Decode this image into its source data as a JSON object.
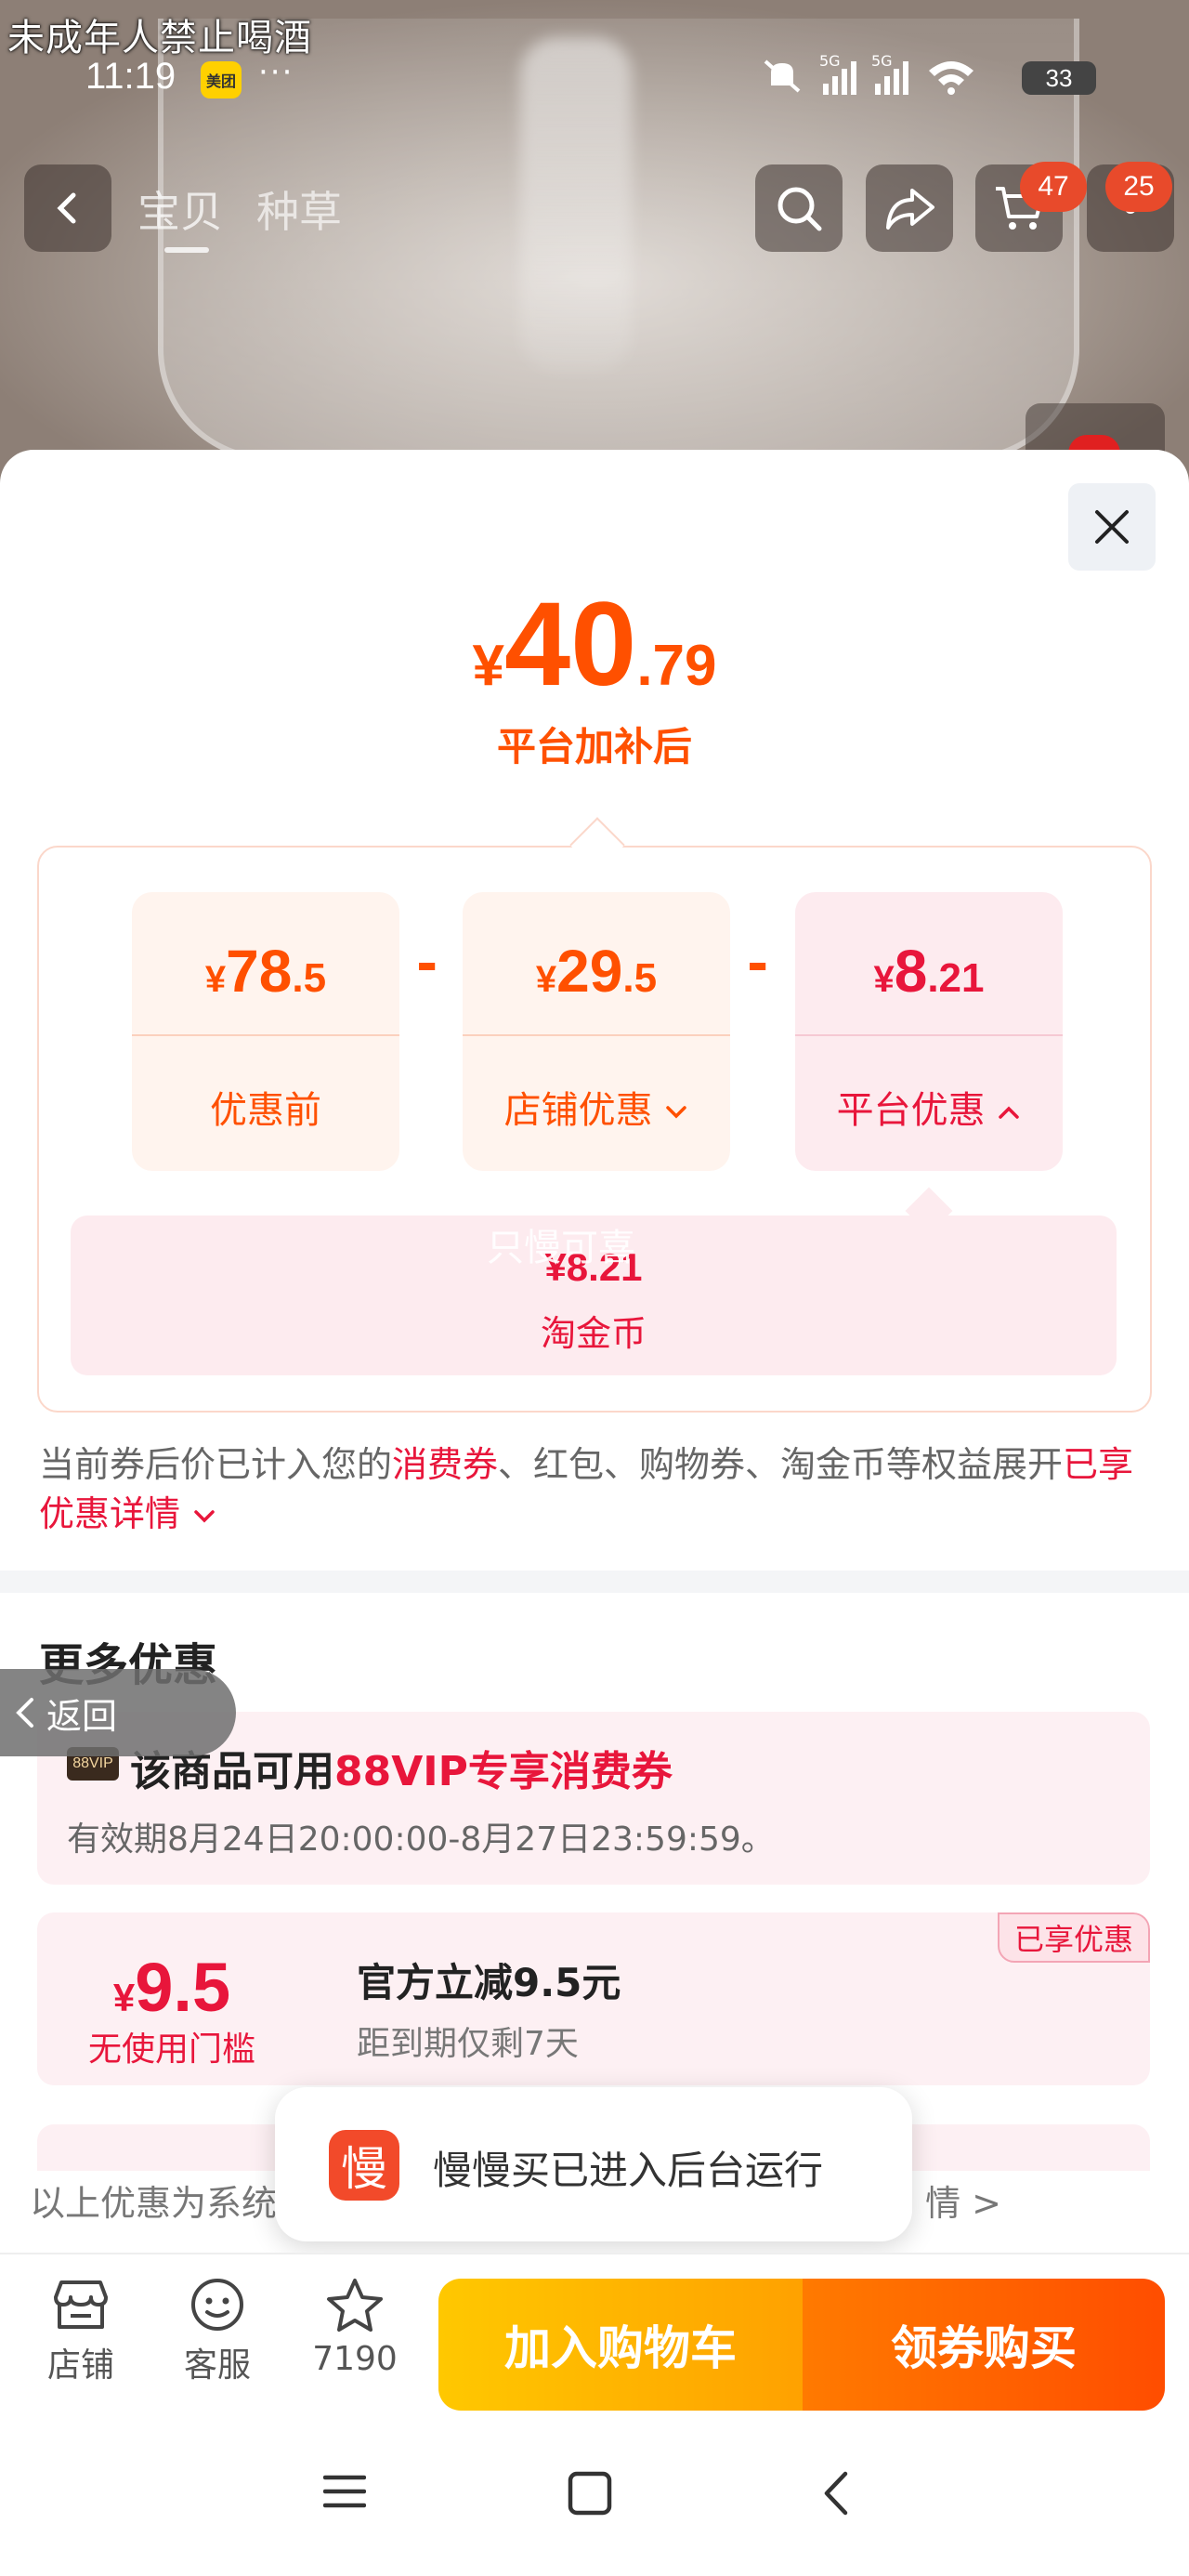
{
  "status_bar": {
    "age_warning": "未成年人禁止喝酒",
    "time": "11:19",
    "app_badge": "美团",
    "dots": "···",
    "network_1": "5G",
    "network_2": "5G",
    "battery": "33"
  },
  "nav": {
    "tabs": [
      "宝贝",
      "种草"
    ],
    "cart_count": "47",
    "message_count": "25"
  },
  "price": {
    "currency": "¥",
    "integer": "40",
    "decimal": ".79",
    "caption": "平台加补后"
  },
  "breakdown": {
    "items": [
      {
        "currency": "¥",
        "integer": "78",
        "decimal": ".5",
        "label": "优惠前"
      },
      {
        "currency": "¥",
        "integer": "29",
        "decimal": ".5",
        "label": "店铺优惠"
      },
      {
        "currency": "¥",
        "integer": "8",
        "decimal": ".21",
        "label": "平台优惠"
      }
    ],
    "operator": "-",
    "coin": {
      "value": "¥8.21",
      "label": "淘金币",
      "watermark": "只慢可喜"
    }
  },
  "disclaimer": {
    "text_1": "当前券后价已计入您的",
    "highlight": "消费券",
    "text_2": "、红包、购物券、淘金币等权益展开",
    "link": "已享优惠详情"
  },
  "more": {
    "title": "更多优惠",
    "return_label": "返回",
    "vip": {
      "badge": "88VIP",
      "text_1": "该商品可用",
      "highlight": "88VIP专享消费券",
      "valid": "有效期8月24日20:00:00-8月27日23:59:59。"
    },
    "coupon": {
      "currency": "¥",
      "amount": "9.5",
      "condition": "无使用门槛",
      "title": "官方立减9.5元",
      "subtitle": "距到期仅剩7天",
      "tag": "已享优惠"
    },
    "footnote_left": "以上优惠为系统",
    "footnote_right": "情 >"
  },
  "toast": {
    "icon_char": "慢",
    "text": "慢慢买已进入后台运行"
  },
  "bottom_bar": {
    "shop": "店铺",
    "service": "客服",
    "favorites": "7190",
    "add_to_cart": "加入购物车",
    "buy": "领券购买"
  }
}
